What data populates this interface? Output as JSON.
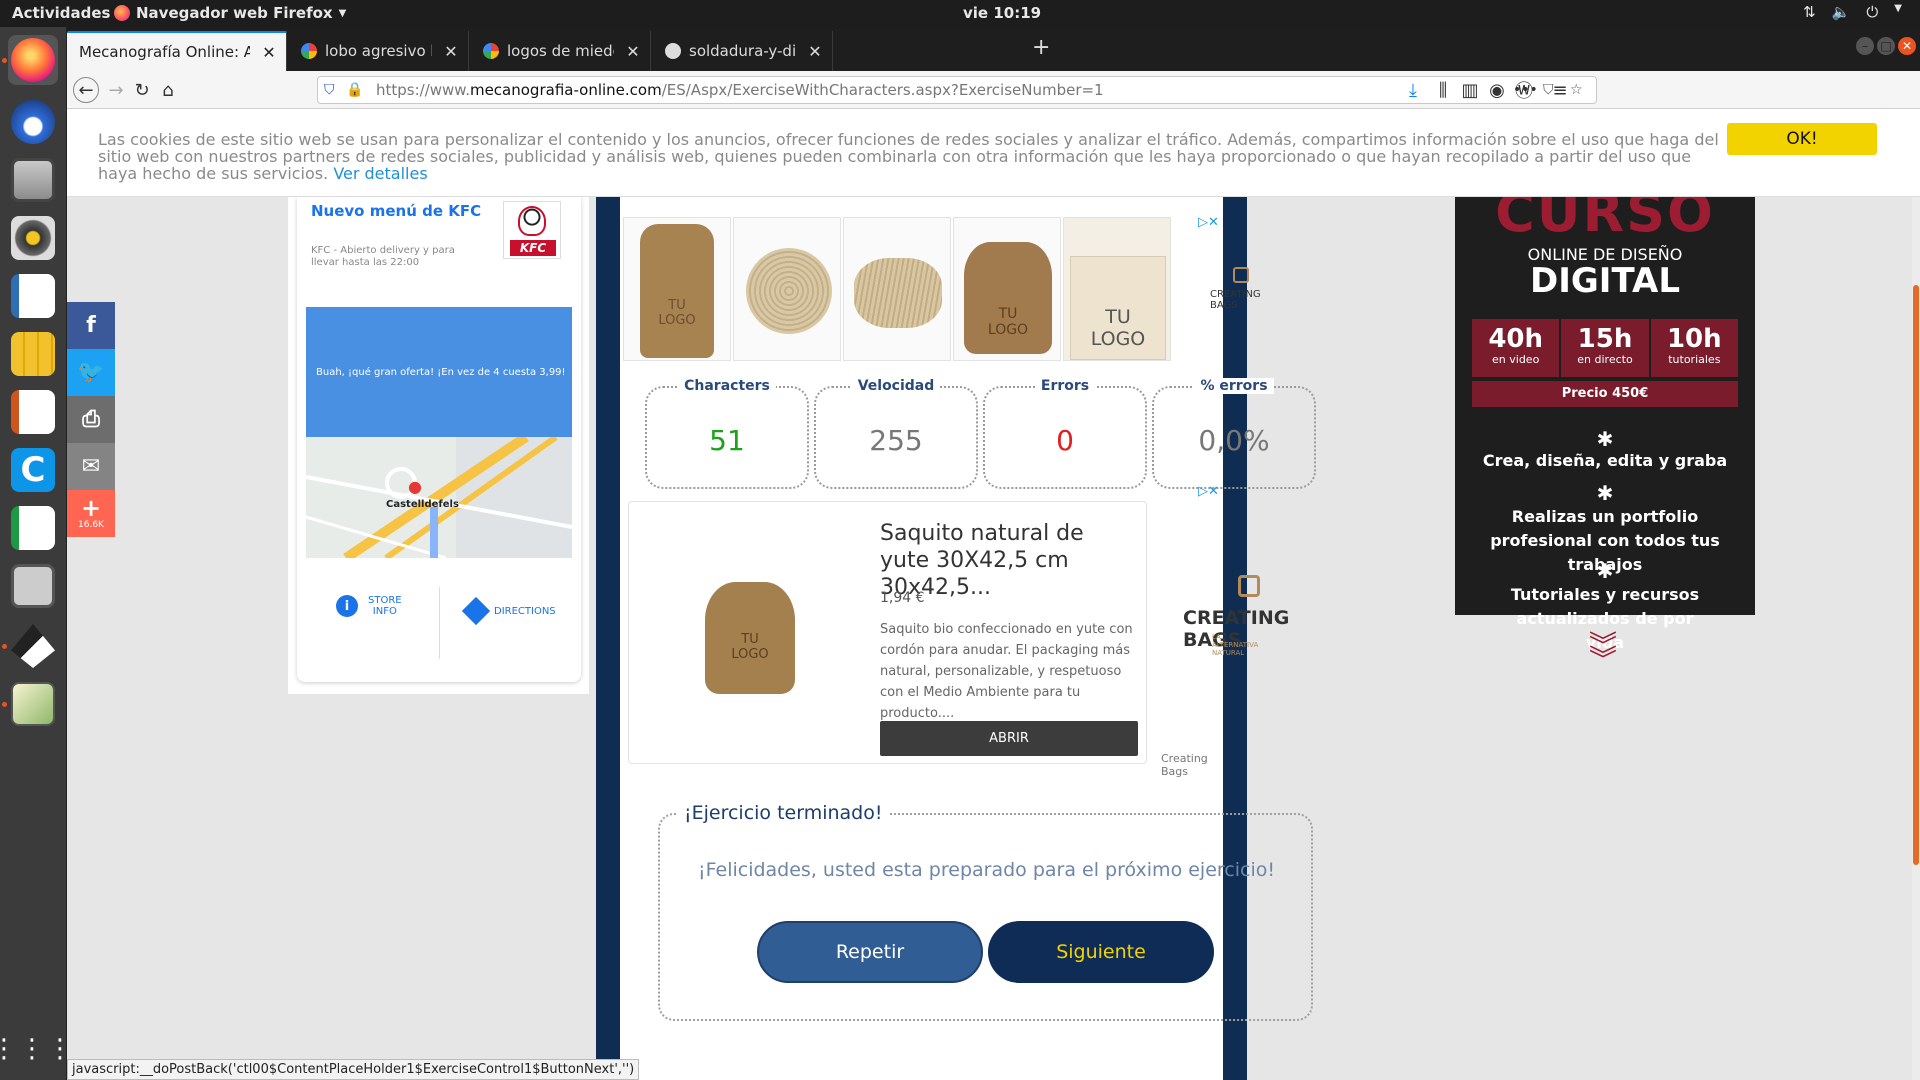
{
  "topbar": {
    "activities": "Actividades",
    "app_name": "Navegador web Firefox",
    "clock": "vie 10:19"
  },
  "tabs": [
    {
      "title": "Mecanografía Online: Apren",
      "color": "#3b6fb6"
    },
    {
      "title": "lobo agresivo blanco y ne",
      "color": "#4285f4"
    },
    {
      "title": "logos de miedo - Cerca de",
      "color": "#4285f4"
    },
    {
      "title": "soldadura-y-dise-/inkscap",
      "color": "#333333"
    }
  ],
  "navbar": {
    "url_prefix": "https://www.",
    "url_host": "mecanografia-online.com",
    "url_path": "/ES/Aspx/ExerciseWithCharacters.aspx?ExerciseNumber=1"
  },
  "cookie": {
    "text": "Las cookies de este sitio web se usan para personalizar el contenido y los anuncios, ofrecer funciones de redes sociales y analizar el tráfico. Además, compartimos información sobre el uso que haga del sitio web con nuestros partners de redes sociales, publicidad y análisis web, quienes pueden combinarla con otra información que les haya proporcionado o que hayan recopilado a partir del uso que haya hecho de sus servicios.",
    "link": "Ver detalles",
    "ok": "OK!"
  },
  "social": {
    "count": "16.6K",
    "colors": {
      "facebook": "#3b5998",
      "twitter": "#1da1f2",
      "print": "#6d6d6d",
      "email": "#848484",
      "share": "#ff6550"
    }
  },
  "kfc": {
    "title": "Nuevo menú de KFC",
    "subtitle": "KFC - Abierto delivery y para llevar hasta las 22:00",
    "logo": "KFC",
    "promo": "Buah, ¡qué gran oferta! ¡En vez de 4 cuesta 3,99!",
    "map_label": "Castelldefels",
    "store_info": "STORE\nINFO",
    "directions": "DIRECTIONS"
  },
  "ad_top": {
    "products": [
      "TU\nLOGO",
      "",
      "",
      "TU\nLOGO",
      "TU\nLOGO"
    ],
    "brand": "CREATING BAGS"
  },
  "stats": [
    {
      "label": "Characters",
      "value": "51",
      "color": "#1aa31a"
    },
    {
      "label": "Velocidad",
      "value": "255",
      "color": "#7a7f8a"
    },
    {
      "label": "Errors",
      "value": "0",
      "color": "#e02020"
    },
    {
      "label": "% errors",
      "value": "0,0%",
      "color": "#7a7f8a"
    }
  ],
  "ad_card": {
    "headline": "Saquito natural de yute 30X42,5 cm 30x42,5...",
    "price": "1,94 €",
    "description": "Saquito bio confeccionado en yute con cordón para anudar. El packaging más natural, personalizable, y respetuoso con el Medio Ambiente para tu producto....",
    "button": "ABRIR",
    "bag_text": "TU\nLOGO",
    "brand": "CREATING BAGS",
    "brand_tag": "LA ALTERNATIVA NATURAL",
    "source": "Creating Bags"
  },
  "result": {
    "title": "¡Ejercicio terminado!",
    "message": "¡Felicidades, usted esta preparado para el próximo ejercicio!",
    "repeat": "Repetir",
    "next": "Siguiente"
  },
  "right_ad": {
    "headline": "CURSO",
    "sub": "ONLINE DE DISEÑO",
    "big": "DIGITAL",
    "stats": [
      {
        "num": "40h",
        "lbl": "en video"
      },
      {
        "num": "15h",
        "lbl": "en directo"
      },
      {
        "num": "10h",
        "lbl": "tutoriales"
      }
    ],
    "price": "Precio 450€",
    "bullets": [
      "Crea, diseña, edita y graba",
      "Realizas un portfolio profesional con todos tus trabajos",
      "Tutoriales y recursos actualizados de por vida"
    ]
  },
  "status_bar": "javascript:__doPostBack('ctl00$ContentPlaceHolder1$ExerciseControl1$ButtonNext','')"
}
